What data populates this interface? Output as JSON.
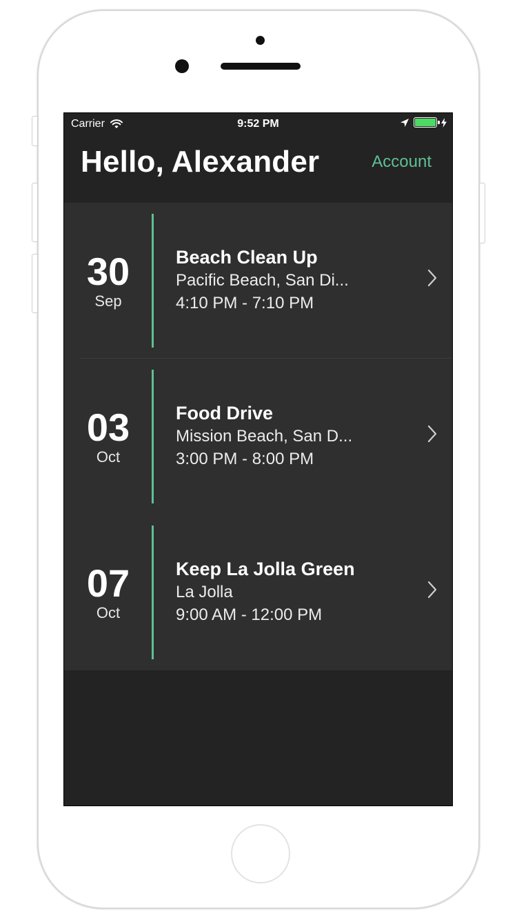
{
  "status_bar": {
    "carrier": "Carrier",
    "time": "9:52 PM",
    "icons": [
      "wifi-icon",
      "location-arrow-icon",
      "battery-icon",
      "charging-bolt-icon"
    ]
  },
  "header": {
    "greeting": "Hello, Alexander",
    "account_label": "Account"
  },
  "events": [
    {
      "day": "30",
      "month": "Sep",
      "title": "Beach Clean Up",
      "location": "Pacific Beach, San Di...",
      "time": "4:10 PM  -  7:10 PM"
    },
    {
      "day": "03",
      "month": "Oct",
      "title": "Food Drive",
      "location": "Mission Beach, San D...",
      "time": "3:00 PM  -  8:00 PM"
    },
    {
      "day": "07",
      "month": "Oct",
      "title": "Keep La Jolla Green",
      "location": "La Jolla",
      "time": "9:00 AM  -  12:00 PM"
    }
  ],
  "colors": {
    "accent": "#5fbf94",
    "background": "#232323",
    "list_background": "#2f2f2f",
    "battery": "#4cd964"
  }
}
